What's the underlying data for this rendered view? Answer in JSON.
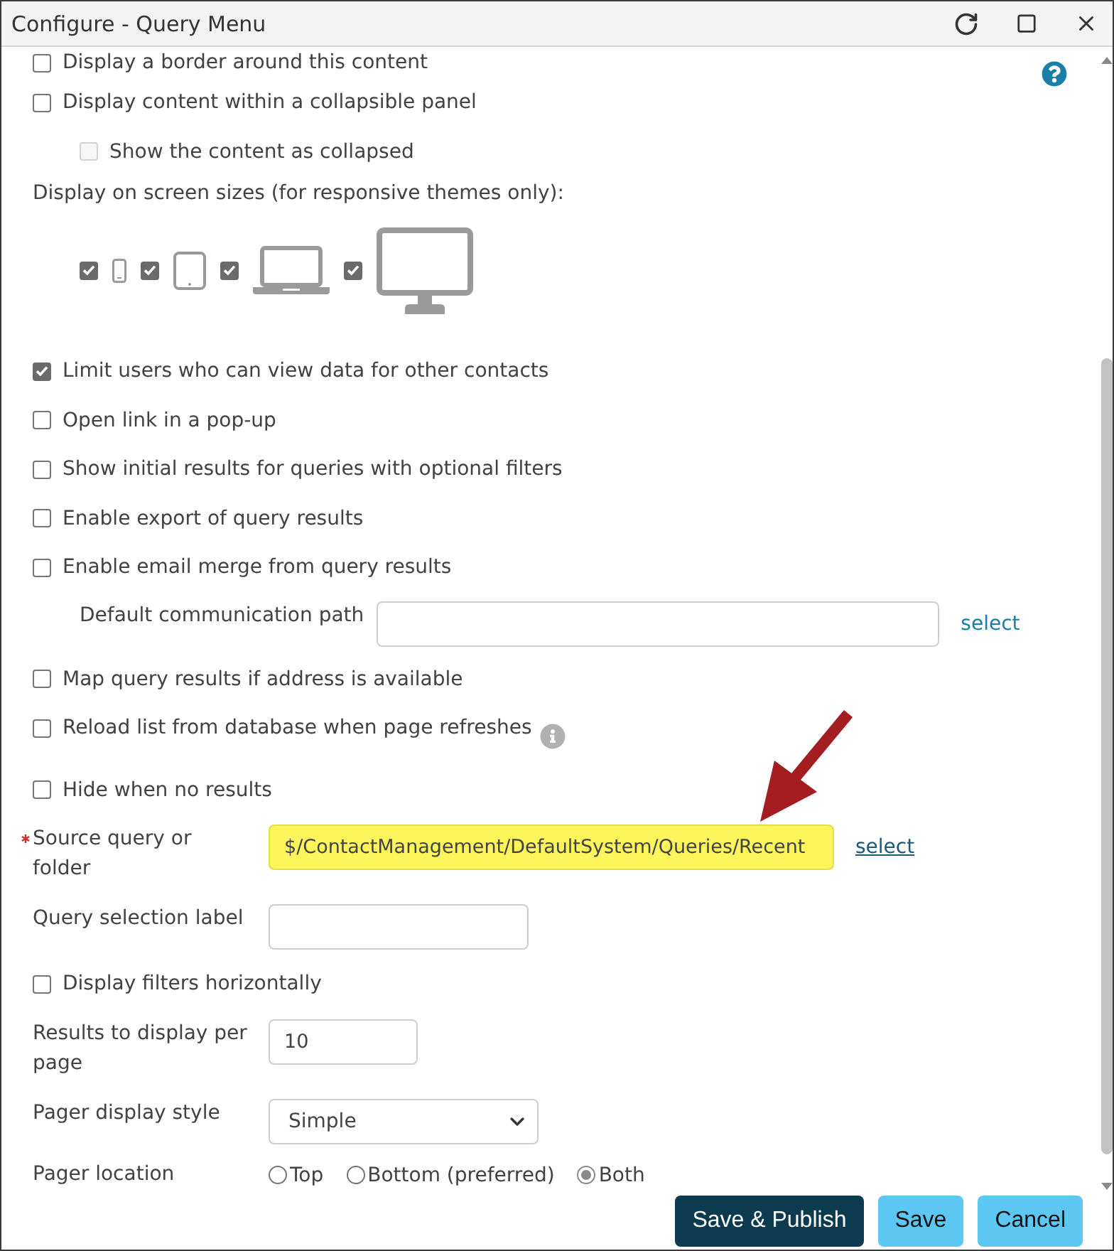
{
  "window": {
    "title": "Configure - Query Menu"
  },
  "form": {
    "items": [
      {
        "kind": "checkbox",
        "label": "Display a border around this content",
        "checked": false,
        "disabled": false
      },
      {
        "kind": "checkbox",
        "label": "Display content within a collapsible panel",
        "checked": false,
        "disabled": false,
        "children": [
          {
            "kind": "checkbox",
            "label": "Show the content as collapsed",
            "checked": false,
            "disabled": true
          }
        ]
      },
      {
        "kind": "heading",
        "label": "Display on screen sizes (for responsive themes only):"
      },
      {
        "kind": "devices",
        "devices": [
          {
            "kind": "phone",
            "checked": true
          },
          {
            "kind": "tablet",
            "checked": true
          },
          {
            "kind": "laptop",
            "checked": true
          },
          {
            "kind": "desktop",
            "checked": true
          }
        ]
      },
      {
        "kind": "checkbox",
        "label": "Limit users who can view data for other contacts",
        "checked": true,
        "disabled": false
      },
      {
        "kind": "checkbox",
        "label": "Open link in a pop-up",
        "checked": false,
        "disabled": false
      },
      {
        "kind": "checkbox",
        "label": "Show initial results for queries with optional filters",
        "checked": false,
        "disabled": false
      },
      {
        "kind": "checkbox",
        "label": "Enable export of query results",
        "checked": false,
        "disabled": false
      },
      {
        "kind": "checkbox",
        "label": "Enable email merge from query results",
        "checked": false,
        "disabled": false,
        "children": [
          {
            "kind": "text",
            "label": "Default communication path",
            "required": false,
            "highlighted": false,
            "link": {
              "label": "select",
              "underlined": false
            }
          }
        ]
      },
      {
        "kind": "checkbox",
        "label": "Map query results if address is available",
        "checked": false,
        "disabled": false
      },
      {
        "kind": "checkbox",
        "label": "Reload list from database when page refreshes",
        "checked": false,
        "disabled": false,
        "info": true
      },
      {
        "kind": "checkbox",
        "label": "Hide when no results",
        "checked": false,
        "disabled": false
      },
      {
        "kind": "text",
        "label": "Source query or folder",
        "required": true,
        "highlighted": true,
        "value": "$/ContactManagement/DefaultSystem/Queries/Recent",
        "link": {
          "label": "select",
          "underlined": true
        }
      },
      {
        "kind": "text",
        "label": "Query selection label",
        "required": false,
        "highlighted": false
      },
      {
        "kind": "checkbox",
        "label": "Display filters horizontally",
        "checked": false,
        "disabled": false
      },
      {
        "kind": "number",
        "label": "Results to display per page",
        "required": false,
        "highlighted": false,
        "value": "10"
      },
      {
        "kind": "select",
        "label": "Pager display style",
        "value": "Simple"
      },
      {
        "kind": "radio",
        "label": "Pager location",
        "options": [
          {
            "label": "Top",
            "selected": false
          },
          {
            "label": "Bottom (preferred)",
            "selected": false
          },
          {
            "label": "Both",
            "selected": true
          }
        ]
      }
    ]
  },
  "buttons": [
    {
      "label": "Save & Publish",
      "kind": "primary"
    },
    {
      "label": "Save",
      "kind": "secondary"
    },
    {
      "label": "Cancel",
      "kind": "secondary"
    }
  ]
}
